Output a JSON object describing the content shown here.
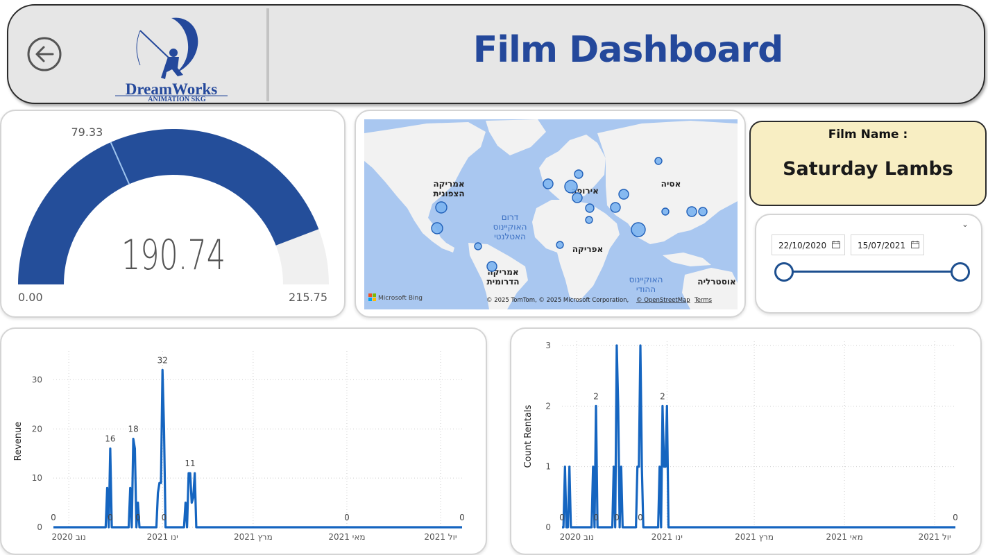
{
  "header": {
    "title": "Film Dashboard",
    "logo": {
      "text_main": "DreamWorks",
      "text_sub": "ANIMATION SKG"
    },
    "back_icon": "back-arrow-icon"
  },
  "gauge": {
    "value": 190.74,
    "value_label": "190.74",
    "min": 0,
    "min_label": "0.00",
    "max": 215.75,
    "max_label": "215.75",
    "target": 79.33,
    "target_label": "79.33",
    "fill_color": "#244e9a",
    "track_color": "#f0f0f0"
  },
  "map": {
    "labels": {
      "north_america": [
        "אמריקה",
        "הצפונית"
      ],
      "europe": "אירופה",
      "asia": "אסיה",
      "africa": "אפריקה",
      "south_america": [
        "אמריקה",
        "הדרומית"
      ],
      "australia": "אוסטרליה",
      "atlantic": [
        "דרום",
        "האוקיינוס",
        "האטלנטי"
      ],
      "indian": [
        "האוקיינוס",
        "ההודי"
      ]
    },
    "bing_label": "Microsoft Bing",
    "attribution_prefix": "© 2025 TomTom, © 2025 Microsoft Corporation,",
    "attribution_osm": "© OpenStreetMap",
    "attribution_terms": "Terms"
  },
  "film": {
    "label": "Film Name :",
    "value": "Saturday Lambs"
  },
  "slicer": {
    "start_date": "22/10/2020",
    "end_date": "15/07/2021",
    "start_position": 0,
    "end_position": 1
  },
  "chart_data": [
    {
      "type": "line",
      "ylabel": "Revenue",
      "xlabel": "",
      "ylim": [
        0,
        35
      ],
      "yticks": [
        0,
        10,
        20,
        30
      ],
      "xrange": [
        "2020-10-22",
        "2021-07-15"
      ],
      "xticks": [
        {
          "date": "2020-11-01",
          "label": "נוב 2020"
        },
        {
          "date": "2021-01-01",
          "label": "ינו 2021"
        },
        {
          "date": "2021-03-01",
          "label": "מרץ 2021"
        },
        {
          "date": "2021-05-01",
          "label": "מאי 2021"
        },
        {
          "date": "2021-07-01",
          "label": "יול 2021"
        }
      ],
      "grid": true,
      "series": [
        {
          "color": "#1565c0",
          "points": [
            [
              "2020-10-22",
              0
            ],
            [
              "2020-11-25",
              0
            ],
            [
              "2020-11-26",
              8
            ],
            [
              "2020-11-27",
              0
            ],
            [
              "2020-11-28",
              16
            ],
            [
              "2020-11-29",
              0
            ],
            [
              "2020-12-10",
              0
            ],
            [
              "2020-12-11",
              8
            ],
            [
              "2020-12-12",
              0
            ],
            [
              "2020-12-13",
              18
            ],
            [
              "2020-12-14",
              16
            ],
            [
              "2020-12-15",
              0
            ],
            [
              "2020-12-16",
              5
            ],
            [
              "2020-12-17",
              0
            ],
            [
              "2020-12-28",
              0
            ],
            [
              "2020-12-29",
              7
            ],
            [
              "2020-12-30",
              9
            ],
            [
              "2020-12-31",
              9
            ],
            [
              "2021-01-01",
              32
            ],
            [
              "2021-01-02",
              20
            ],
            [
              "2021-01-03",
              0
            ],
            [
              "2021-01-15",
              0
            ],
            [
              "2021-01-16",
              5
            ],
            [
              "2021-01-17",
              0
            ],
            [
              "2021-01-18",
              11
            ],
            [
              "2021-01-19",
              11
            ],
            [
              "2021-01-20",
              5
            ],
            [
              "2021-01-21",
              6
            ],
            [
              "2021-01-22",
              11
            ],
            [
              "2021-01-23",
              0
            ],
            [
              "2021-07-15",
              0
            ]
          ]
        }
      ],
      "data_labels": [
        {
          "date": "2020-10-22",
          "value": 0,
          "text": "0"
        },
        {
          "date": "2020-11-28",
          "value": 16,
          "text": "16"
        },
        {
          "date": "2020-11-28",
          "value": 0,
          "text": "0"
        },
        {
          "date": "2020-12-13",
          "value": 18,
          "text": "18"
        },
        {
          "date": "2020-12-16",
          "value": 0,
          "text": "0"
        },
        {
          "date": "2021-01-01",
          "value": 32,
          "text": "32"
        },
        {
          "date": "2021-01-02",
          "value": 0,
          "text": "0"
        },
        {
          "date": "2021-01-19",
          "value": 11,
          "text": "11"
        },
        {
          "date": "2021-05-01",
          "value": 0,
          "text": "0"
        },
        {
          "date": "2021-07-15",
          "value": 0,
          "text": "0"
        }
      ]
    },
    {
      "type": "line",
      "ylabel": "Count Rentals",
      "xlabel": "",
      "ylim": [
        0,
        3
      ],
      "yticks": [
        0,
        1,
        2,
        3
      ],
      "xrange": [
        "2020-10-22",
        "2021-07-15"
      ],
      "xticks": [
        {
          "date": "2020-11-01",
          "label": "נוב 2020"
        },
        {
          "date": "2021-01-01",
          "label": "ינו 2021"
        },
        {
          "date": "2021-03-01",
          "label": "מרץ 2021"
        },
        {
          "date": "2021-05-01",
          "label": "מאי 2021"
        },
        {
          "date": "2021-07-01",
          "label": "יול 2021"
        }
      ],
      "grid": true,
      "series": [
        {
          "color": "#1565c0",
          "points": [
            [
              "2020-10-22",
              0
            ],
            [
              "2020-10-23",
              0
            ],
            [
              "2020-10-24",
              1
            ],
            [
              "2020-10-25",
              0
            ],
            [
              "2020-10-26",
              0
            ],
            [
              "2020-10-27",
              1
            ],
            [
              "2020-10-28",
              0
            ],
            [
              "2020-11-11",
              0
            ],
            [
              "2020-11-12",
              1
            ],
            [
              "2020-11-13",
              0
            ],
            [
              "2020-11-14",
              2
            ],
            [
              "2020-11-15",
              0
            ],
            [
              "2020-11-25",
              0
            ],
            [
              "2020-11-26",
              1
            ],
            [
              "2020-11-27",
              0
            ],
            [
              "2020-11-28",
              3
            ],
            [
              "2020-11-29",
              2
            ],
            [
              "2020-11-30",
              0
            ],
            [
              "2020-12-01",
              1
            ],
            [
              "2020-12-02",
              0
            ],
            [
              "2020-12-11",
              0
            ],
            [
              "2020-12-12",
              1
            ],
            [
              "2020-12-13",
              1
            ],
            [
              "2020-12-14",
              3
            ],
            [
              "2020-12-15",
              1
            ],
            [
              "2020-12-16",
              0
            ],
            [
              "2020-12-26",
              0
            ],
            [
              "2020-12-27",
              1
            ],
            [
              "2020-12-28",
              0
            ],
            [
              "2020-12-29",
              2
            ],
            [
              "2020-12-30",
              1
            ],
            [
              "2020-12-31",
              1
            ],
            [
              "2021-01-01",
              2
            ],
            [
              "2021-01-02",
              0
            ],
            [
              "2021-07-15",
              0
            ]
          ]
        }
      ],
      "data_labels": [
        {
          "date": "2020-10-22",
          "value": 0,
          "text": "0"
        },
        {
          "date": "2020-11-14",
          "value": 2,
          "text": "2"
        },
        {
          "date": "2020-11-14",
          "value": 0,
          "text": "0"
        },
        {
          "date": "2020-11-28",
          "value": 0,
          "text": "0"
        },
        {
          "date": "2020-12-14",
          "value": 0,
          "text": "0"
        },
        {
          "date": "2020-12-29",
          "value": 2,
          "text": "2"
        },
        {
          "date": "2021-07-15",
          "value": 0,
          "text": "0"
        }
      ]
    }
  ]
}
